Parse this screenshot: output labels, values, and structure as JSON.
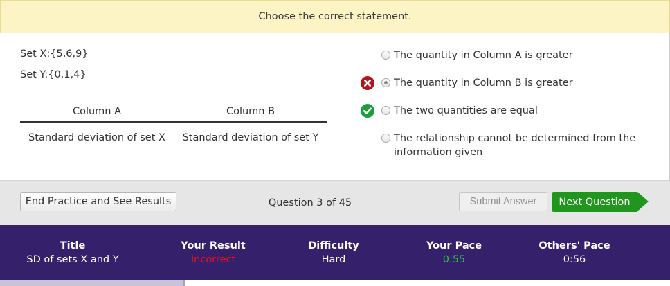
{
  "banner": {
    "text": "Choose the correct statement."
  },
  "question": {
    "set_x": "Set X:{5,6,9}",
    "set_y": "Set Y:{0,1,4}",
    "table": {
      "headers": [
        "Column A",
        "Column B"
      ],
      "row": [
        "Standard deviation of set X",
        "Standard deviation of set Y"
      ]
    }
  },
  "options": [
    {
      "text": "The quantity in Column A is greater",
      "selected": false,
      "mark": ""
    },
    {
      "text": "The quantity in Column B is greater",
      "selected": true,
      "mark": "x-circle-icon"
    },
    {
      "text": "The two quantities are equal",
      "selected": false,
      "mark": "check-circle-icon"
    },
    {
      "text": "The relationship cannot be determined from the information given",
      "selected": false,
      "mark": ""
    }
  ],
  "toolbar": {
    "end_label": "End Practice and See Results",
    "question_count": "Question 3 of 45",
    "submit_label": "Submit Answer",
    "next_label": "Next Question"
  },
  "stats": {
    "title_label": "Title",
    "title_value": "SD of sets X and Y",
    "result_label": "Your Result",
    "result_value": "Incorrect",
    "difficulty_label": "Difficulty",
    "difficulty_value": "Hard",
    "pace_label": "Your Pace",
    "pace_value": "0:55",
    "others_label": "Others' Pace",
    "others_value": "0:56"
  },
  "colors": {
    "banner_bg": "#fdf4c5",
    "stats_bg": "#35206b",
    "incorrect": "#e8121c",
    "pace_green": "#2fbf45",
    "next_button": "#20961f",
    "wrong_icon": "#b3141b",
    "right_icon": "#1e9e3a"
  }
}
